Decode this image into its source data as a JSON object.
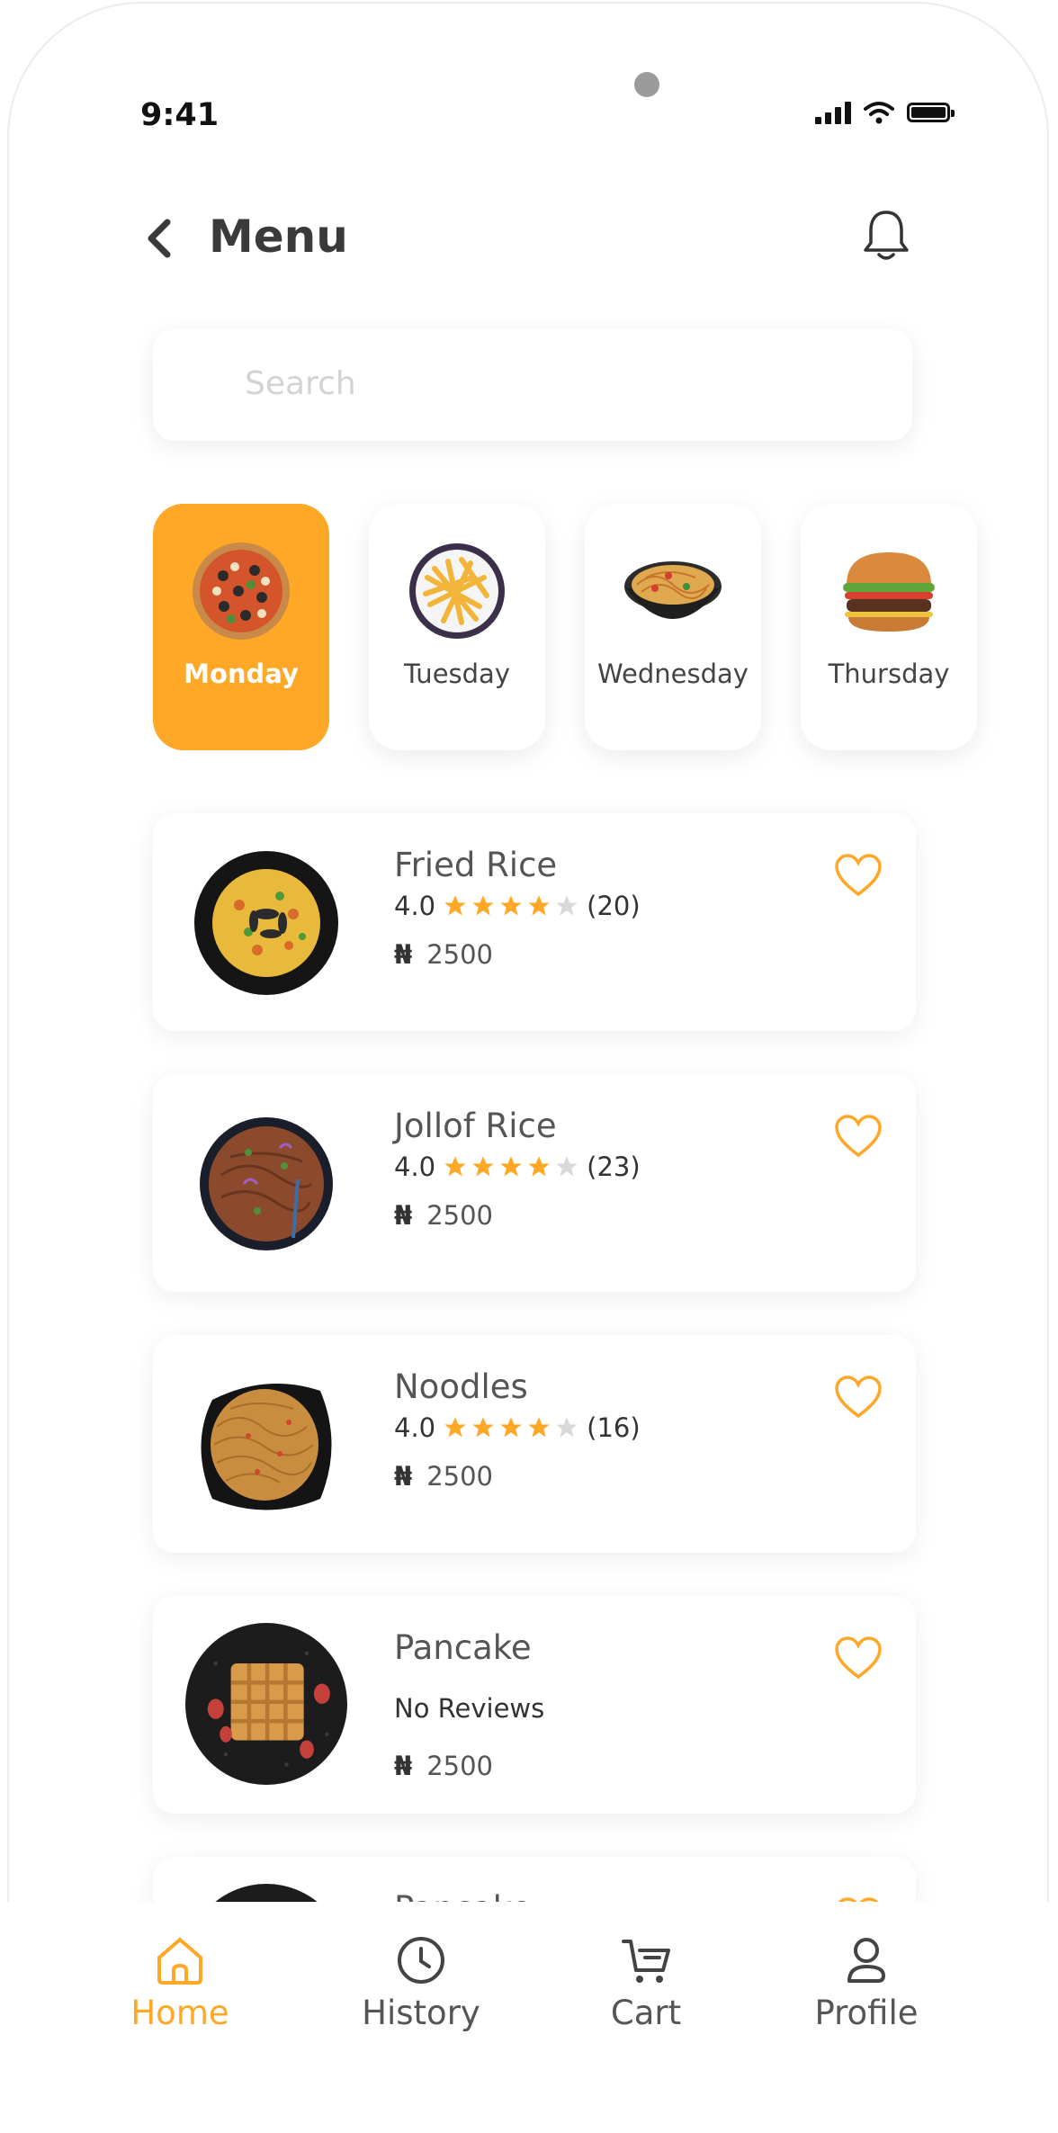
{
  "status_bar": {
    "time": "9:41"
  },
  "header": {
    "title": "Menu"
  },
  "search": {
    "placeholder": "Search"
  },
  "days": [
    {
      "label": "Monday",
      "active": true,
      "icon": "pizza-icon"
    },
    {
      "label": "Tuesday",
      "active": false,
      "icon": "fries-icon"
    },
    {
      "label": "Wednesday",
      "active": false,
      "icon": "noodle-bowl-icon"
    },
    {
      "label": "Thursday",
      "active": false,
      "icon": "burger-icon"
    }
  ],
  "menu_items": [
    {
      "name": "Fried Rice",
      "rating": "4.0",
      "stars": 4,
      "reviews": "(20)",
      "currency": "₦",
      "price": "2500"
    },
    {
      "name": "Jollof Rice",
      "rating": "4.0",
      "stars": 4,
      "reviews": "(23)",
      "currency": "₦",
      "price": "2500"
    },
    {
      "name": "Noodles",
      "rating": "4.0",
      "stars": 4,
      "reviews": "(16)",
      "currency": "₦",
      "price": "2500"
    },
    {
      "name": "Pancake",
      "no_reviews": "No Reviews",
      "currency": "₦",
      "price": "2500"
    },
    {
      "name": "Pancake"
    }
  ],
  "bottom_nav": [
    {
      "label": "Home",
      "active": true,
      "icon": "home-icon"
    },
    {
      "label": "History",
      "active": false,
      "icon": "clock-icon"
    },
    {
      "label": "Cart",
      "active": false,
      "icon": "cart-icon"
    },
    {
      "label": "Profile",
      "active": false,
      "icon": "user-icon"
    }
  ],
  "colors": {
    "accent": "#FFA726",
    "star_filled": "#FFA726",
    "star_empty": "#D9D9D9",
    "text": "#555555"
  }
}
